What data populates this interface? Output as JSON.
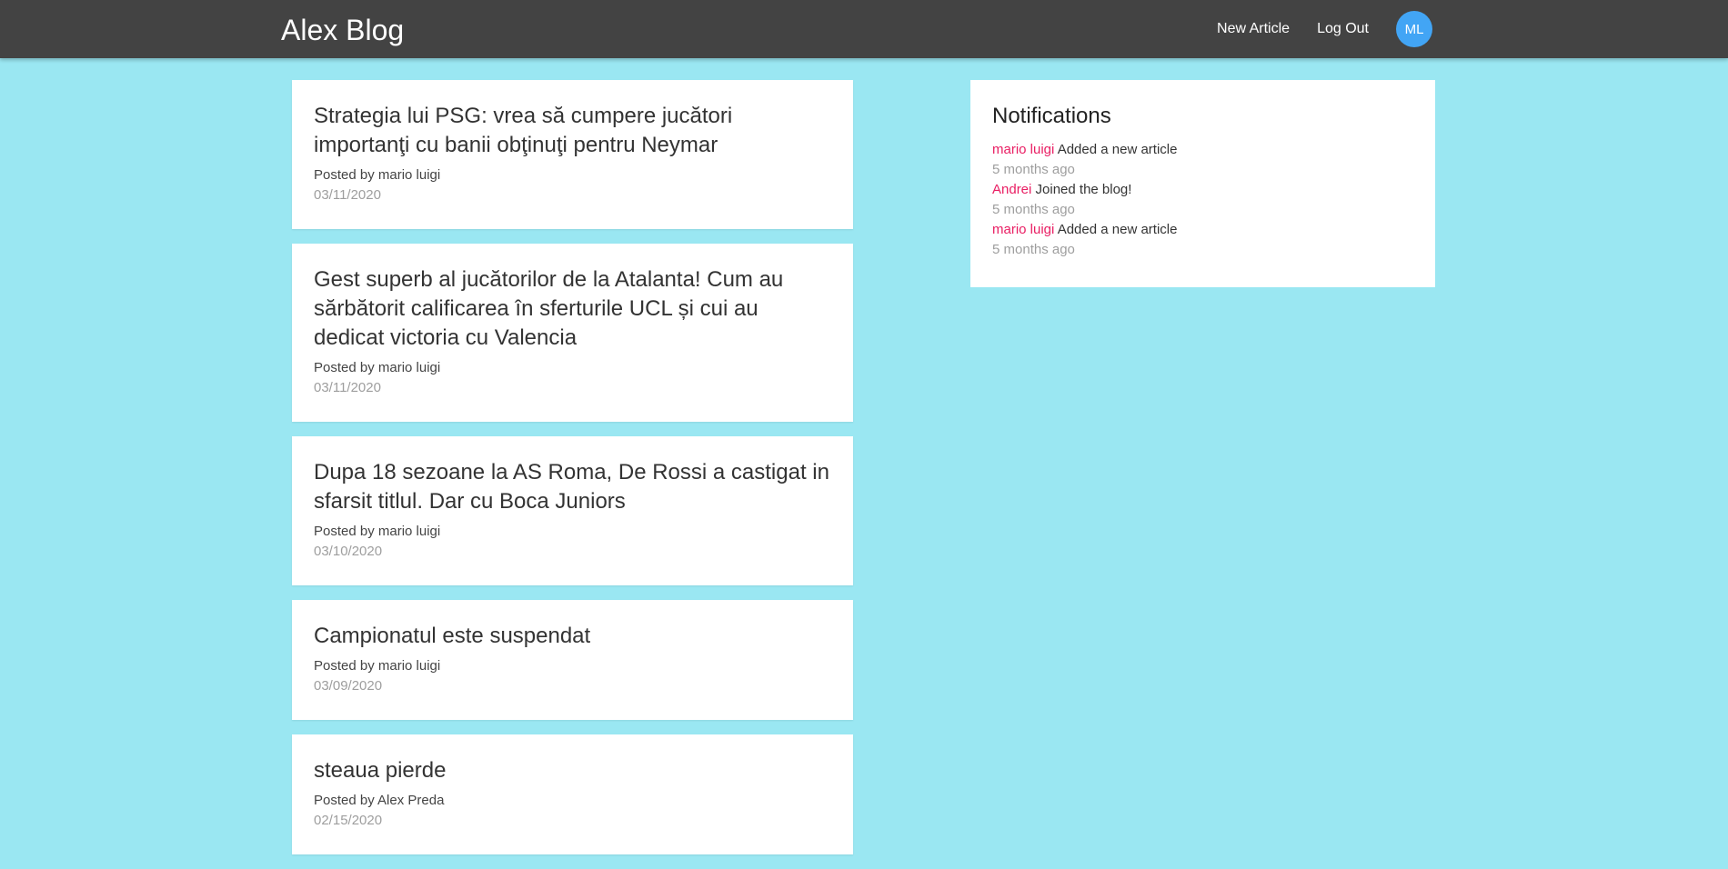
{
  "navbar": {
    "brand": "Alex Blog",
    "new_article": "New Article",
    "log_out": "Log Out",
    "avatar_initials": "ML"
  },
  "articles": [
    {
      "title": "Strategia lui PSG: vrea să cumpere jucători importanţi cu banii obţinuţi pentru Neymar",
      "author": "Posted by mario luigi",
      "date": "03/11/2020"
    },
    {
      "title": "Gest superb al jucătorilor de la Atalanta! Cum au sărbătorit calificarea în sferturile UCL și cui au dedicat victoria cu Valencia",
      "author": "Posted by mario luigi",
      "date": "03/11/2020"
    },
    {
      "title": "Dupa 18 sezoane la AS Roma, De Rossi a castigat in sfarsit titlul. Dar cu Boca Juniors",
      "author": "Posted by mario luigi",
      "date": "03/10/2020"
    },
    {
      "title": "Campionatul este suspendat",
      "author": "Posted by mario luigi",
      "date": "03/09/2020"
    },
    {
      "title": "steaua pierde",
      "author": "Posted by Alex Preda",
      "date": "02/15/2020"
    }
  ],
  "notifications": {
    "title": "Notifications",
    "items": [
      {
        "user": "mario luigi",
        "action": "Added a new article",
        "time": "5 months ago"
      },
      {
        "user": "Andrei",
        "action": "Joined the blog!",
        "time": "5 months ago"
      },
      {
        "user": "mario luigi",
        "action": "Added a new article",
        "time": "5 months ago"
      }
    ]
  },
  "colors": {
    "background": "#9ae7f2",
    "navbar": "#434343",
    "avatar": "#42a5f5",
    "notification_user": "#e91e63"
  }
}
